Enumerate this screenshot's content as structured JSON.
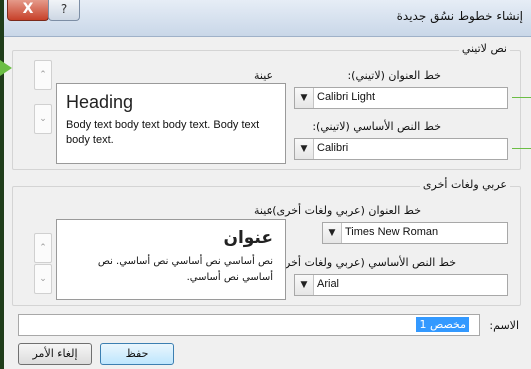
{
  "window": {
    "title": "إنشاء خطوط نسُق جديدة",
    "close_label": "X",
    "help_label": "?"
  },
  "latin": {
    "group_title": "نص لاتيني",
    "heading_label": "خط العنوان (لاتيني):",
    "heading_font": "Calibri Light",
    "body_label": "خط النص الأساسي (لاتيني):",
    "body_font": "Calibri",
    "sample_label": "عينة",
    "sample_heading": "Heading",
    "sample_body": "Body text body text body text. Body text body text."
  },
  "arabic": {
    "group_title": "عربي ولغات أخرى",
    "heading_label": "خط العنوان (عربي ولغات أخرى):",
    "heading_font": "Times New Roman",
    "body_label": "خط النص الأساسي (عربي ولغات أخرى):",
    "body_font": "Arial",
    "sample_label": "عينة",
    "sample_heading": "عنوان",
    "sample_body": "نص أساسي نص أساسي نص أساسي. نص أساسي نص أساسي."
  },
  "name_field": {
    "label": "الاسم:",
    "value": "مخصص 1"
  },
  "buttons": {
    "save": "حفظ",
    "cancel": "إلغاء الأمر"
  }
}
